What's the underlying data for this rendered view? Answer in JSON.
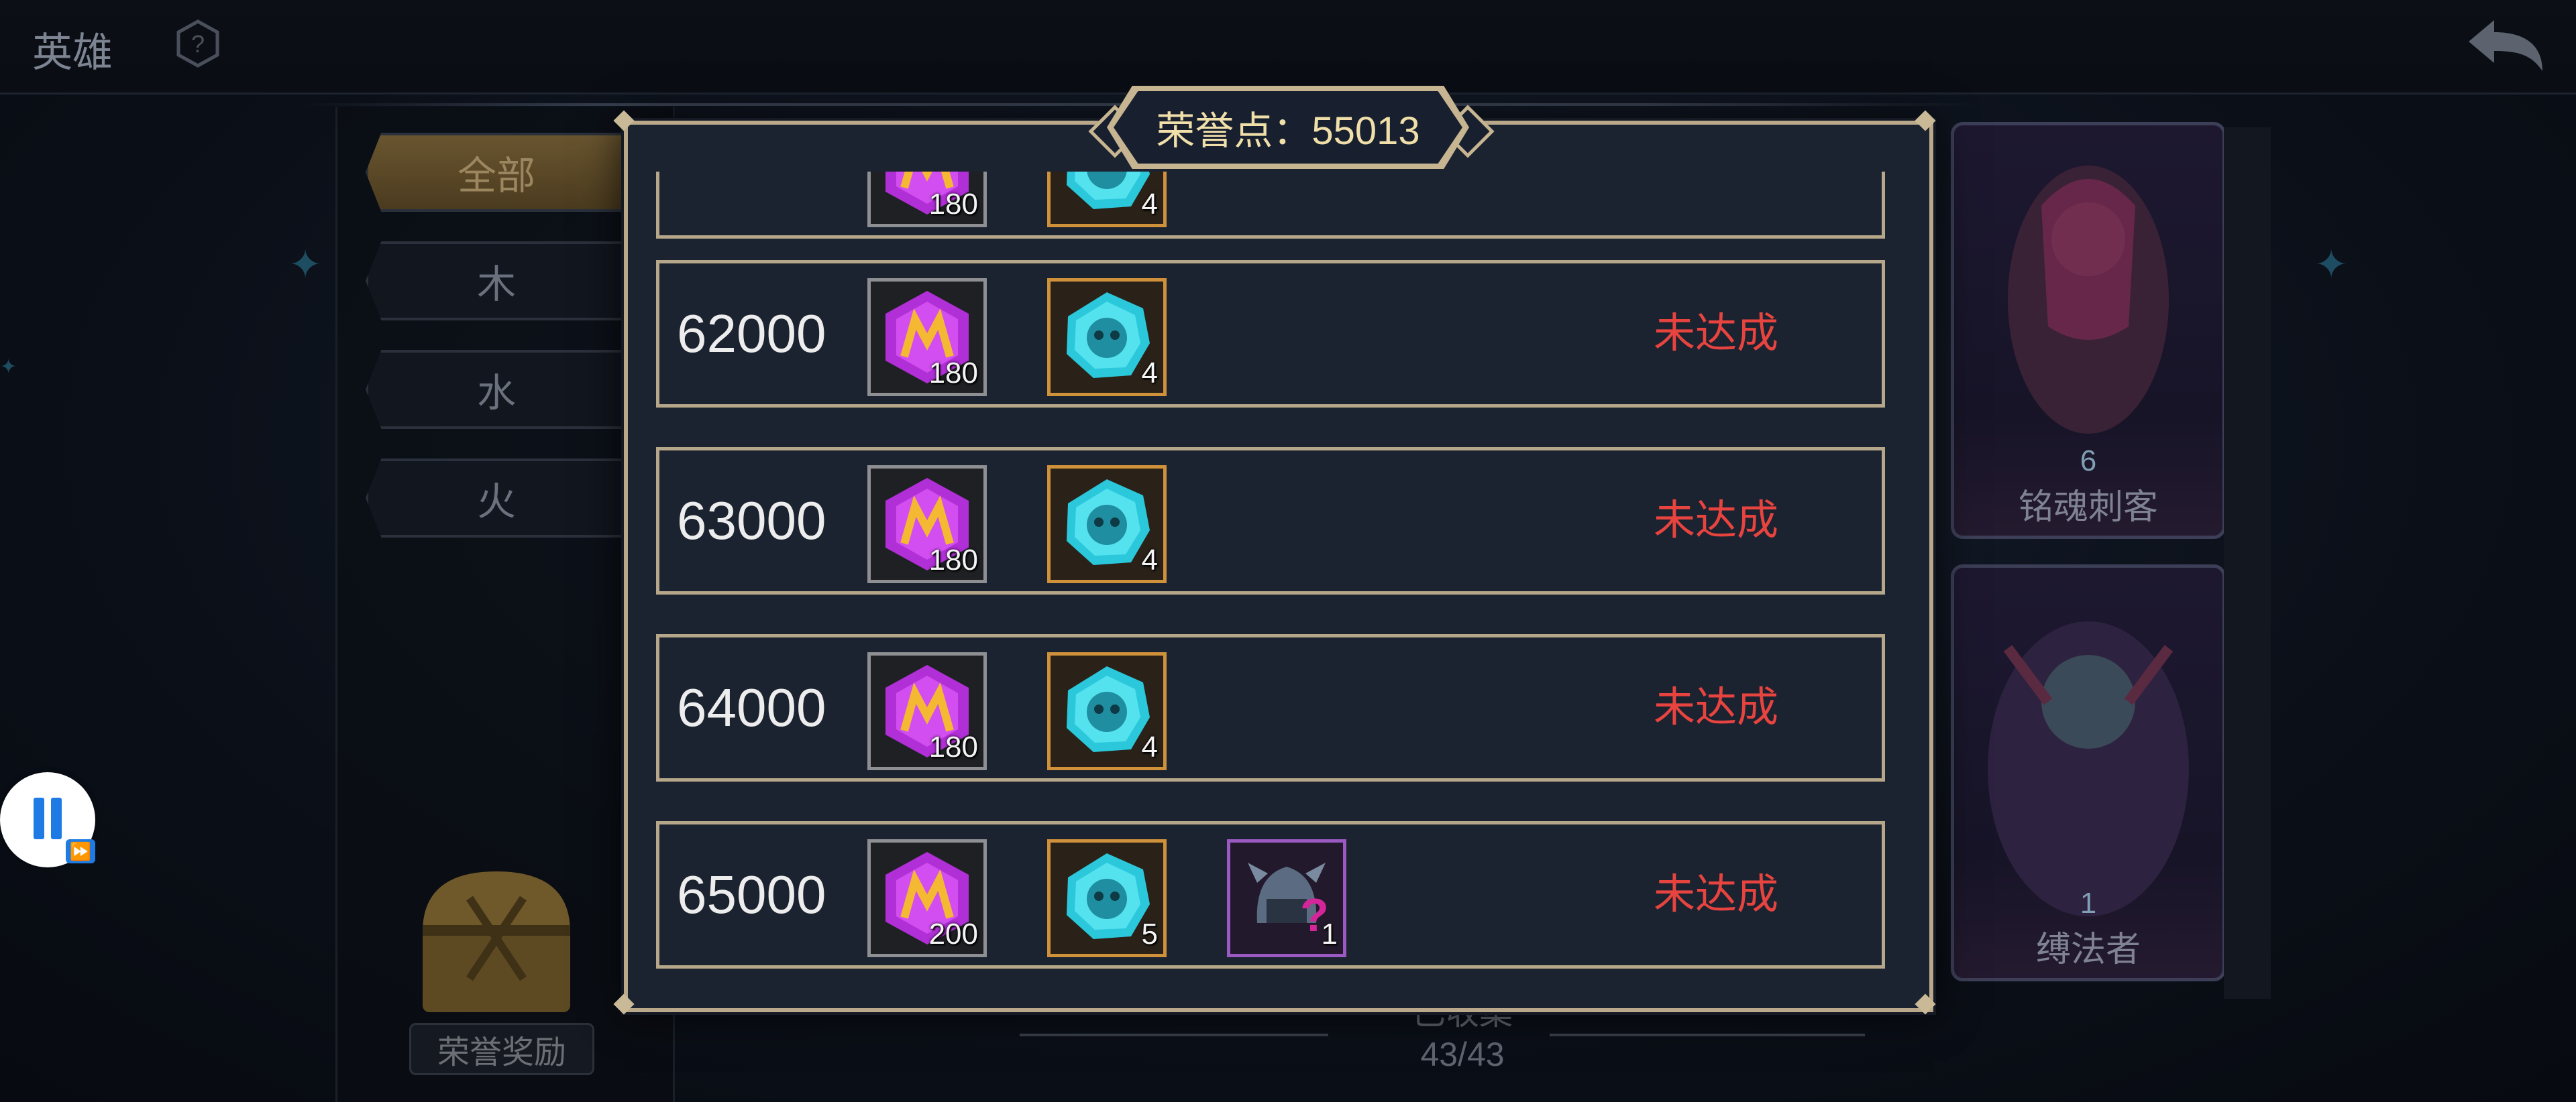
{
  "header": {
    "title": "英雄"
  },
  "filters": [
    {
      "label": "全部",
      "active": true
    },
    {
      "label": "木",
      "active": false
    },
    {
      "label": "水",
      "active": false
    },
    {
      "label": "火",
      "active": false
    }
  ],
  "reward_button": {
    "label": "荣誉奖励"
  },
  "collection": {
    "label": "已收集",
    "count": "43/43"
  },
  "heroes": [
    {
      "name": "铭魂刺客",
      "level": "6",
      "element_icon": "water-drop-icon"
    },
    {
      "name": "缚法者",
      "level": "1",
      "element_icon": "water-drop-icon"
    }
  ],
  "modal": {
    "title": "荣誉点：55013",
    "rows": [
      {
        "points": "",
        "items": [
          {
            "icon": "purple-gem-icon",
            "qty": "180"
          },
          {
            "icon": "cyan-skull-coin-icon",
            "qty": "4"
          }
        ],
        "status": ""
      },
      {
        "points": "62000",
        "items": [
          {
            "icon": "purple-gem-icon",
            "qty": "180"
          },
          {
            "icon": "cyan-skull-coin-icon",
            "qty": "4"
          }
        ],
        "status": "未达成"
      },
      {
        "points": "63000",
        "items": [
          {
            "icon": "purple-gem-icon",
            "qty": "180"
          },
          {
            "icon": "cyan-skull-coin-icon",
            "qty": "4"
          }
        ],
        "status": "未达成"
      },
      {
        "points": "64000",
        "items": [
          {
            "icon": "purple-gem-icon",
            "qty": "180"
          },
          {
            "icon": "cyan-skull-coin-icon",
            "qty": "4"
          }
        ],
        "status": "未达成"
      },
      {
        "points": "65000",
        "items": [
          {
            "icon": "purple-gem-icon",
            "qty": "200"
          },
          {
            "icon": "cyan-skull-coin-icon",
            "qty": "5"
          },
          {
            "icon": "mystery-helmet-icon",
            "qty": "1"
          }
        ],
        "status": "未达成"
      }
    ]
  },
  "colors": {
    "gold_border": "#b6a78a",
    "status_red": "#e8443f",
    "title_gold": "#f1dfaa"
  }
}
